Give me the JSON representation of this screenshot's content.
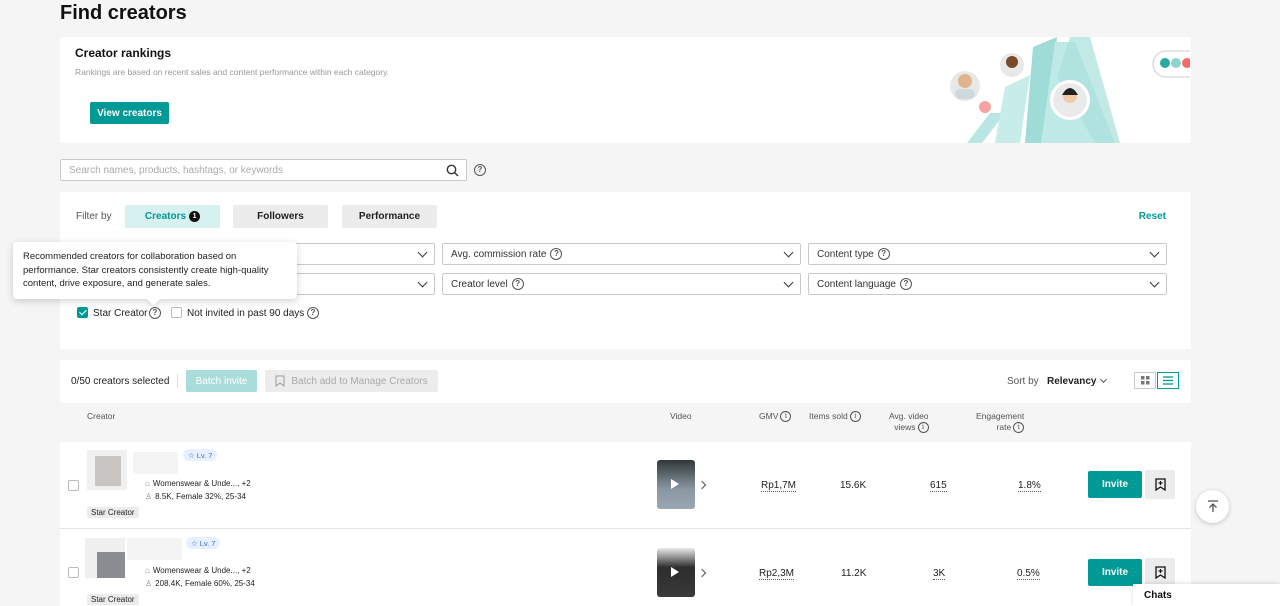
{
  "page": {
    "title": "Find creators"
  },
  "banner": {
    "title": "Creator rankings",
    "description": "Rankings are based on recent sales and content performance within each category.",
    "button_label": "View creators"
  },
  "search": {
    "placeholder": "Search names, products, hashtags, or keywords"
  },
  "filters": {
    "filter_by_label": "Filter by",
    "tabs": [
      {
        "label": "Creators",
        "badge": "1",
        "active": true
      },
      {
        "label": "Followers",
        "active": false
      },
      {
        "label": "Performance",
        "active": false
      }
    ],
    "reset_label": "Reset",
    "dropdowns": [
      {
        "label": ""
      },
      {
        "label": "Avg. commission rate"
      },
      {
        "label": "Content type"
      },
      {
        "label": ""
      },
      {
        "label": "Creator level"
      },
      {
        "label": "Content language"
      }
    ],
    "checkboxes": [
      {
        "label": "Star Creator",
        "checked": true
      },
      {
        "label": "Not invited in past 90 days",
        "checked": false
      }
    ],
    "tooltip": "Recommended creators for collaboration based on performance. Star creators consistently create high-quality content, drive exposure, and generate sales."
  },
  "results": {
    "selected_text": "0/50 creators selected",
    "batch_invite_label": "Batch invite",
    "batch_add_label": "Batch add to Manage Creators",
    "sort_label": "Sort by",
    "sort_value": "Relevancy",
    "columns": {
      "creator": "Creator",
      "video": "Video",
      "gmv": "GMV",
      "items_sold": "Items sold",
      "avg_views_1": "Avg. video",
      "avg_views_2": "views",
      "engagement_1": "Engagement",
      "engagement_2": "rate"
    },
    "rows": [
      {
        "level": "Lv. 7",
        "category": "Womenswear & Unde..., +2",
        "audience": "8.5K, Female 32%, 25-34",
        "tag": "Star Creator",
        "gmv": "Rp1,7M",
        "items_sold": "15.6K",
        "avg_views": "615",
        "engagement": "1.8%",
        "invite_label": "Invite"
      },
      {
        "level": "Lv. 7",
        "category": "Womenswear & Unde..., +2",
        "audience": "208.4K, Female 60%, 25-34",
        "tag": "Star Creator",
        "gmv": "Rp2,3M",
        "items_sold": "11.2K",
        "avg_views": "3K",
        "engagement": "0.5%",
        "invite_label": "Invite"
      }
    ]
  },
  "chats_label": "Chats",
  "colors": {
    "accent": "#009995",
    "accent_light": "#d6f1ef",
    "background": "#f5f5f5"
  },
  "icons": [
    "search-icon",
    "help-icon",
    "chevron-down-icon",
    "info-icon",
    "bookmark-icon",
    "play-icon",
    "grid-view-icon",
    "list-view-icon",
    "back-to-top-icon",
    "shop-icon",
    "user-icon",
    "level-icon"
  ]
}
